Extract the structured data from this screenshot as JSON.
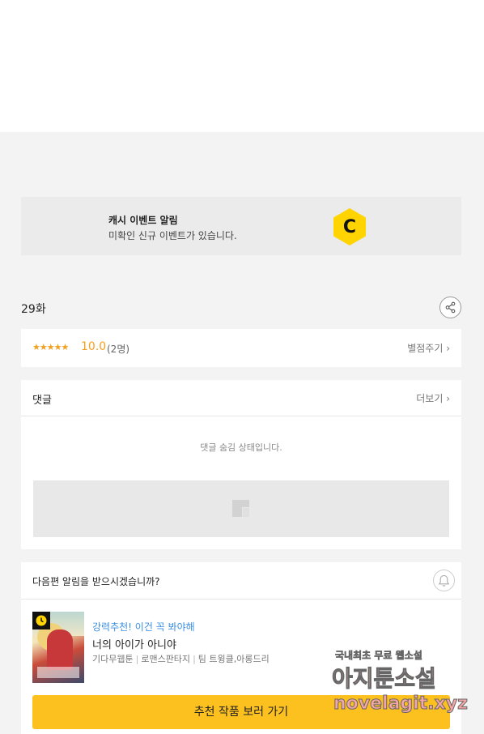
{
  "event_banner": {
    "title": "캐시 이벤트 알림",
    "subtitle": "미확인 신규 이벤트가 있습니다.",
    "logo_letter": "C",
    "logo_color": "#ffd400"
  },
  "episode": {
    "title": "29화"
  },
  "rating": {
    "stars": "★★★★★",
    "stars_value": 5,
    "score": "10.0",
    "count": "(2명)",
    "rate_link": "별점주기 ›"
  },
  "comments": {
    "title": "댓글",
    "more_link": "더보기 ›",
    "hidden_message": "댓글 숨김 상태입니다."
  },
  "subscribe": {
    "question": "다음편 알림을 받으시겠습니까?",
    "bell_icon": "bell-icon"
  },
  "recommendation": {
    "kicker": "강력추천! 이건 꼭 봐야해",
    "title": "너의 아이가 아니야",
    "tags": [
      "기다무웹툰",
      "로맨스판타지",
      "팀 트윙클,아롱드리"
    ],
    "button_label": "추천 작품 보러 가기",
    "button_color": "#fcc01f"
  },
  "watermark": {
    "line1_a": "국내최초 무료",
    "line1_b": "웹소설",
    "line2": "아지툰소설",
    "line3": "novelagit.xyz"
  },
  "colors": {
    "accent_orange": "#f2a01e",
    "link_blue": "#3b8fe0",
    "background": "#f3f3f3"
  }
}
